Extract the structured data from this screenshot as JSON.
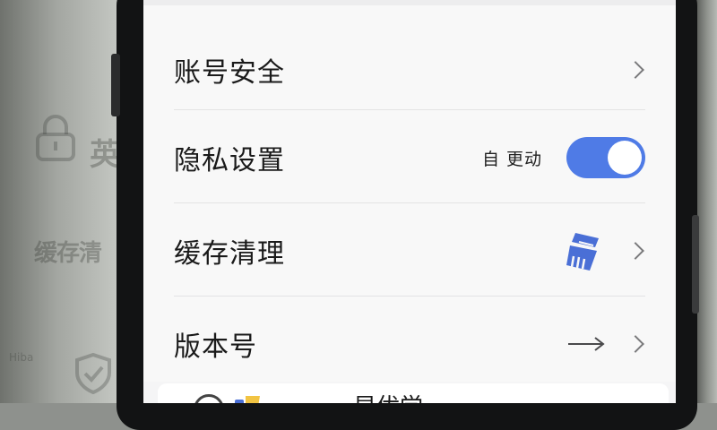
{
  "background": {
    "ghost_text_1": "英",
    "ghost_text_2": "缓存清",
    "ghost_text_3": "Hiba"
  },
  "settings": {
    "items": [
      {
        "label": "账号安全"
      },
      {
        "label": "隐私设置",
        "toggle_text": "自 更动",
        "toggle_on": true
      },
      {
        "label": "缓存清理"
      },
      {
        "label": "版本号"
      }
    ],
    "next_partial_label": "显优学"
  },
  "colors": {
    "toggle_accent": "#4f7be6",
    "icon_accent": "#4a6fd6",
    "bottom_icon": "#f2c443"
  }
}
